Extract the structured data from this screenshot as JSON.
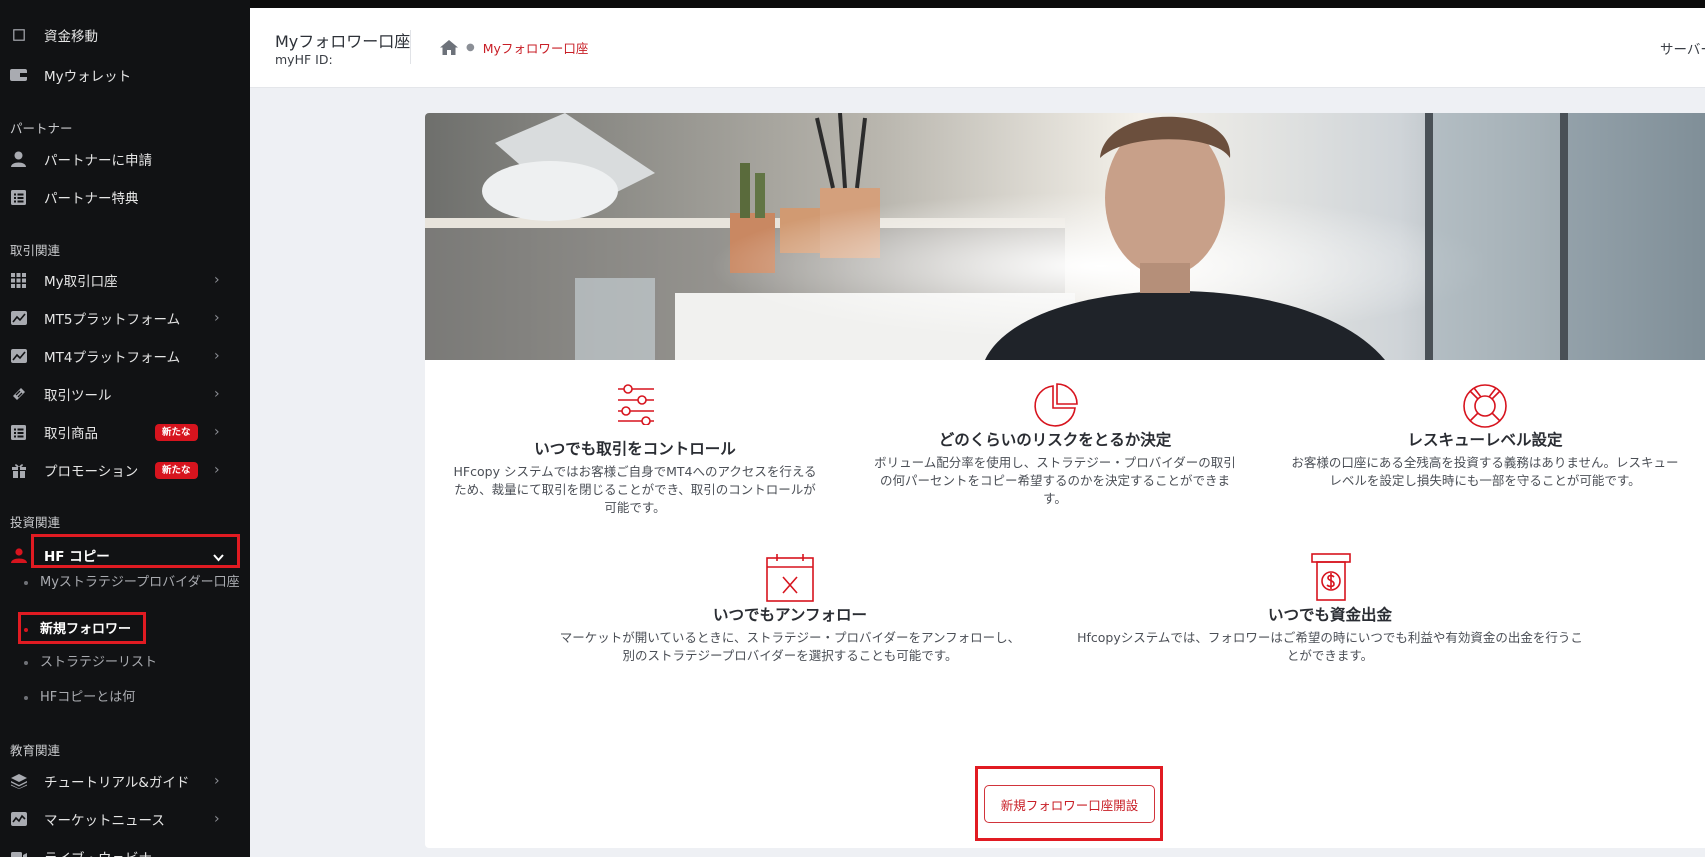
{
  "sidebar": {
    "top_items": [
      {
        "label": "資金移動",
        "icon": "square-icon"
      },
      {
        "label": "Myウォレット",
        "icon": "wallet-icon"
      }
    ],
    "sections": {
      "partner": "パートナー",
      "trading": "取引関連",
      "investment": "投資関連",
      "education": "教育関連"
    },
    "partner_items": [
      {
        "label": "パートナーに申請",
        "icon": "user-icon"
      },
      {
        "label": "パートナー特典",
        "icon": "list-icon"
      }
    ],
    "trading_items": [
      {
        "label": "My取引口座",
        "icon": "grid-icon"
      },
      {
        "label": "MT5プラットフォーム",
        "icon": "chart-icon"
      },
      {
        "label": "MT4プラットフォーム",
        "icon": "chart-icon"
      },
      {
        "label": "取引ツール",
        "icon": "tools-icon"
      },
      {
        "label": "取引商品",
        "icon": "list-icon",
        "badge": "新たな"
      },
      {
        "label": "プロモーション",
        "icon": "gift-icon",
        "badge": "新たな"
      }
    ],
    "hf_copy": {
      "label": "HF コピー",
      "icon": "user-red-icon",
      "subitems": [
        {
          "label": "Myストラテジープロバイダー口座"
        },
        {
          "label": "新規フォロワー",
          "active": true
        },
        {
          "label": "ストラテジーリスト"
        },
        {
          "label": "HFコピーとは何"
        }
      ]
    },
    "education_items": [
      {
        "label": "チュートリアル&ガイド",
        "icon": "layers-icon"
      },
      {
        "label": "マーケットニュース",
        "icon": "chart-icon"
      },
      {
        "label": "ライブ・ウェビナー",
        "icon": "video-icon"
      }
    ]
  },
  "header": {
    "title": "Myフォロワー口座",
    "myhf_id": "myHF ID:",
    "breadcrumb_current": "Myフォロワー口座",
    "server_label": "サーバー"
  },
  "features": [
    {
      "icon": "sliders-icon",
      "title": "いつでも取引をコントロール",
      "desc": "HFcopy システムではお客様ご自身でMT4へのアクセスを行えるため、裁量にて取引を閉じることができ、取引のコントロールが可能です。"
    },
    {
      "icon": "pie-icon",
      "title": "どのくらいのリスクをとるか決定",
      "desc": "ボリューム配分率を使用し、ストラテジー・プロバイダーの取引の何パーセントをコピー希望するのかを決定することができます。"
    },
    {
      "icon": "lifebuoy-icon",
      "title": "レスキューレベル設定",
      "desc": "お客様の口座にある全残高を投資する義務はありません。レスキューレベルを設定し損失時にも一部を守ることが可能です。"
    },
    {
      "icon": "calendar-x-icon",
      "title": "いつでもアンフォロー",
      "desc": "マーケットが開いているときに、ストラテジー・プロバイダーをアンフォローし、別のストラテジープロバイダーを選択することも可能です。"
    },
    {
      "icon": "atm-icon",
      "title": "いつでも資金出金",
      "desc": "Hfcopyシステムでは、フォロワーはご希望の時にいつでも利益や有効資金の出金を行うことができます。"
    }
  ],
  "cta": {
    "label": "新規フォロワー口座開設"
  },
  "colors": {
    "accent": "#d7141e",
    "sidebar_bg": "#111214",
    "page_bg": "#eef0f4"
  }
}
